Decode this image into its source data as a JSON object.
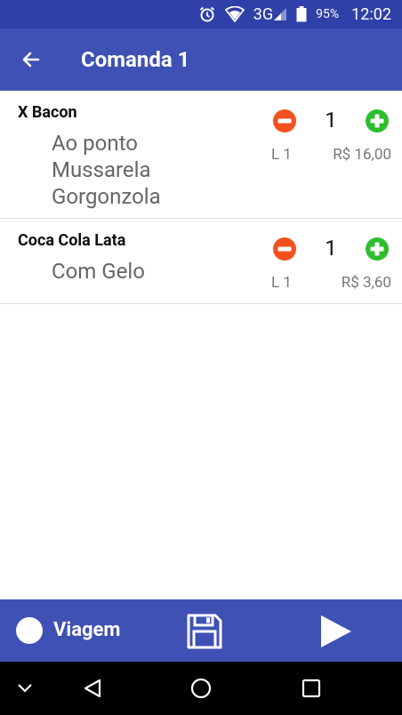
{
  "status_bar": {
    "network": "3G",
    "battery": "95%",
    "time": "12:02",
    "icons": [
      "alarm-icon",
      "wifi-icon",
      "signal-icon",
      "battery-icon"
    ]
  },
  "app_bar": {
    "title": "Comanda 1",
    "back_icon": "arrow-left-icon"
  },
  "items": [
    {
      "name": "X Bacon",
      "modifiers": [
        "Ao ponto",
        "Mussarela",
        "Gorgonzola"
      ],
      "quantity": "1",
      "line": "L 1",
      "price": "R$ 16,00"
    },
    {
      "name": "Coca Cola Lata",
      "modifiers": [
        "Com Gelo"
      ],
      "quantity": "1",
      "line": "L 1",
      "price": "R$ 3,60"
    }
  ],
  "bottom_bar": {
    "viagem_label": "Viagem",
    "save_icon": "floppy-disk-icon",
    "send_icon": "play-icon"
  },
  "colors": {
    "primary": "#3f51b5",
    "primary_dark": "#2f41a8",
    "remove": "#f4511e",
    "add": "#2dbe2d"
  }
}
